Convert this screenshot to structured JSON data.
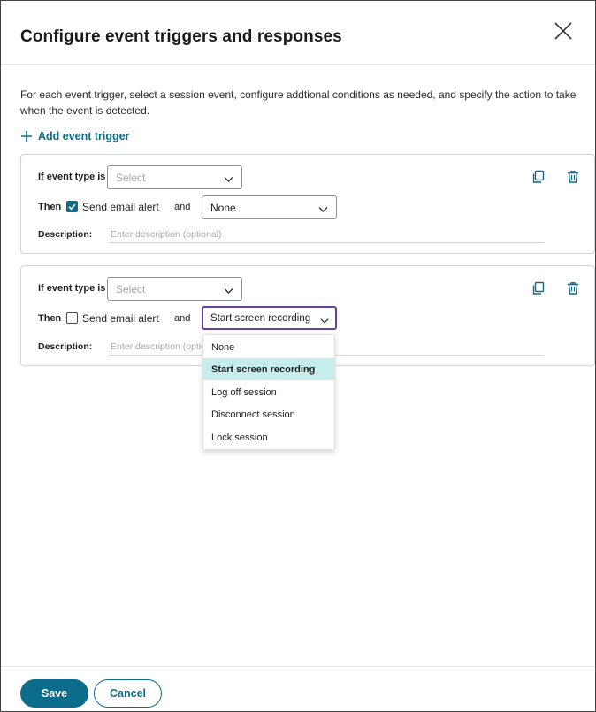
{
  "dialog": {
    "title": "Configure event triggers and responses",
    "intro": "For each event trigger, select a session event, configure addtional conditions as needed, and specify the action to take when the event is detected.",
    "add_trigger_label": "Add event trigger",
    "close_icon": "close-icon"
  },
  "triggers": [
    {
      "event_label": "If event type is",
      "event_placeholder": "Select",
      "then_label": "Then",
      "email_checked": true,
      "email_label": "Send email alert",
      "and_label": "and",
      "action_value": "None",
      "description_label": "Description:",
      "description_placeholder": "Enter description (optional)"
    },
    {
      "event_label": "If event type is",
      "event_placeholder": "Select",
      "then_label": "Then",
      "email_checked": false,
      "email_label": "Send email alert",
      "and_label": "and",
      "action_value": "Start screen recording",
      "description_label": "Description:",
      "description_placeholder": "Enter description (optional)"
    }
  ],
  "action_dropdown": {
    "options": [
      "None",
      "Start screen recording",
      "Log off session",
      "Disconnect session",
      "Lock session"
    ],
    "selected": "Start screen recording"
  },
  "footer": {
    "save_label": "Save",
    "cancel_label": "Cancel"
  },
  "colors": {
    "accent": "#0b6d8a",
    "focus": "#6b3fa0",
    "selected_option": "#c6ecec"
  }
}
